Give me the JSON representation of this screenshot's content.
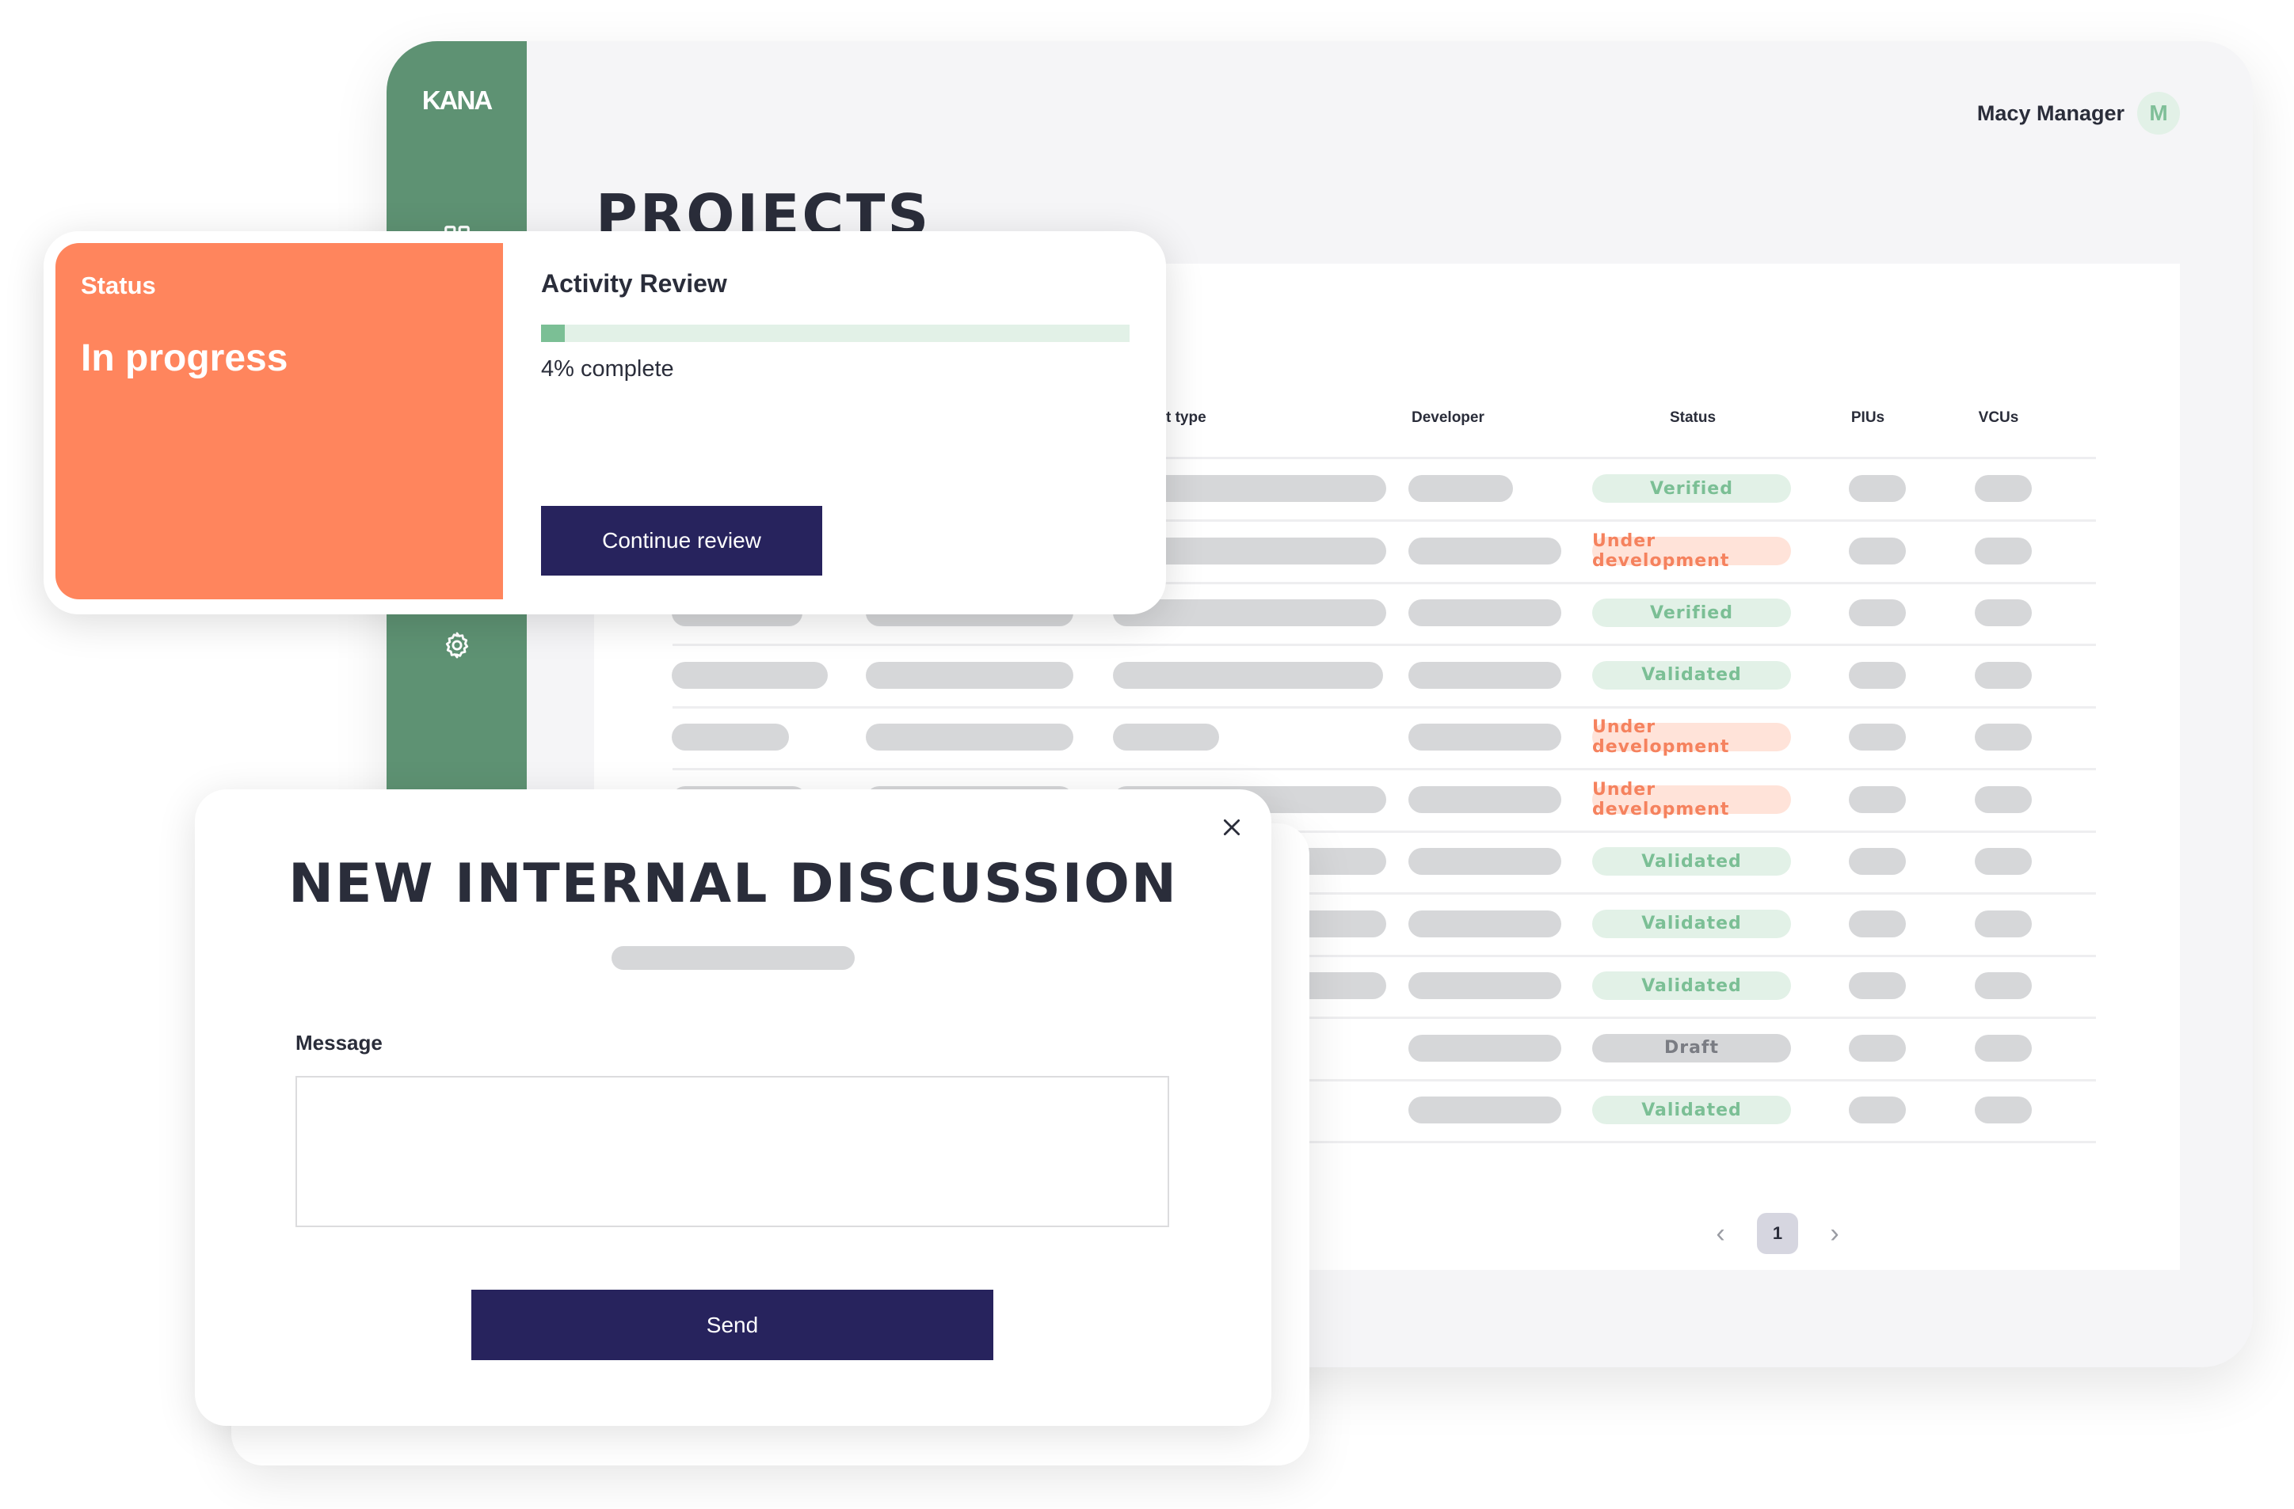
{
  "app": {
    "logo": "KANA",
    "page_title": "PROJECTS",
    "user": {
      "name": "Macy Manager",
      "avatar_initial": "M"
    }
  },
  "sidebar": {
    "items": [
      {
        "icon": "grid-icon"
      },
      {
        "icon": "gear-icon"
      }
    ]
  },
  "table": {
    "headers": {
      "credit_type": "t type",
      "developer": "Developer",
      "status": "Status",
      "pius": "PIUs",
      "vcus": "VCUs"
    },
    "rows": [
      {
        "status": "Verified",
        "status_kind": "success"
      },
      {
        "status": "Under development",
        "status_kind": "warning"
      },
      {
        "status": "Verified",
        "status_kind": "success"
      },
      {
        "status": "Validated",
        "status_kind": "success"
      },
      {
        "status": "Under development",
        "status_kind": "warning"
      },
      {
        "status": "Under development",
        "status_kind": "warning"
      },
      {
        "status": "Validated",
        "status_kind": "success"
      },
      {
        "status": "Validated",
        "status_kind": "success"
      },
      {
        "status": "Validated",
        "status_kind": "success"
      },
      {
        "status": "Draft",
        "status_kind": "neutral"
      },
      {
        "status": "Validated",
        "status_kind": "success"
      }
    ],
    "pagination": {
      "current_page": "1",
      "prev_icon": "chevron-left-icon",
      "next_icon": "chevron-right-icon"
    }
  },
  "status_card": {
    "status_label": "Status",
    "status_value": "In progress",
    "review_title": "Activity Review",
    "progress_percent": 4,
    "progress_text": "4% complete",
    "continue_label": "Continue review"
  },
  "discussion_modal": {
    "title": "NEW INTERNAL DISCUSSION",
    "message_label": "Message",
    "message_value": "",
    "send_label": "Send",
    "close_icon": "close-icon"
  },
  "colors": {
    "sidebar": "#5e9273",
    "status_orange": "#ff855d",
    "primary_button": "#27235d",
    "success_bg": "#e2f1e7",
    "success_text": "#7bbf95",
    "warning_bg": "#ffe3d9",
    "warning_text": "#f5825e",
    "neutral_bg": "#d6d7d9",
    "neutral_text": "#7a7c83"
  }
}
